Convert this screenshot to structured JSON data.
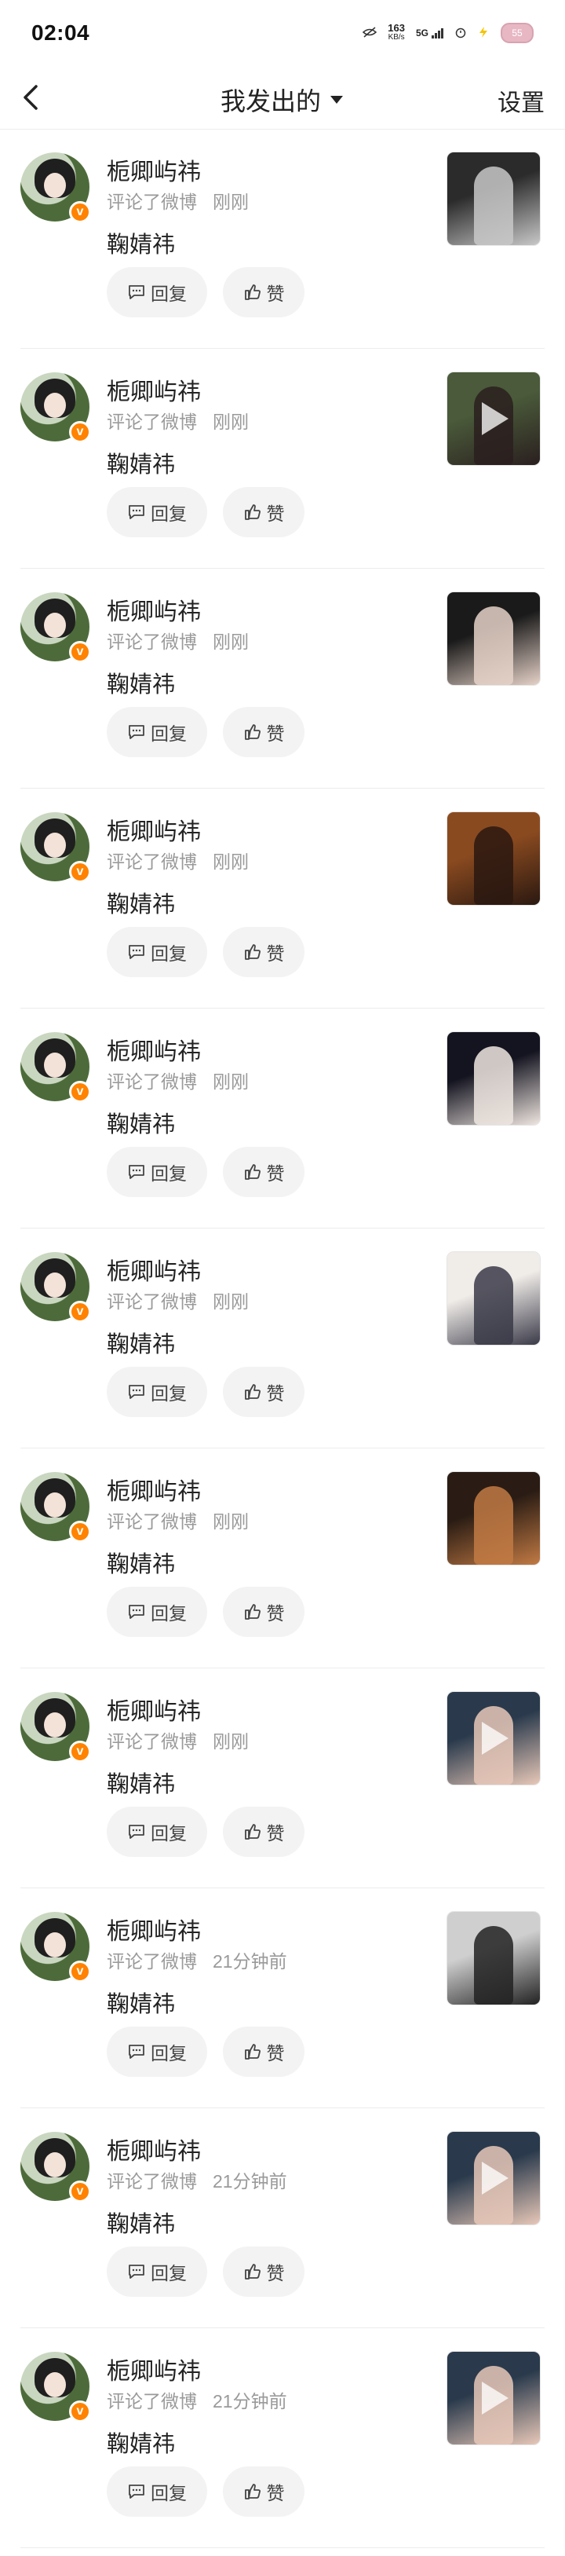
{
  "status_bar": {
    "time": "02:04",
    "net_speed_value": "163",
    "net_speed_unit": "KB/s",
    "network": "5G",
    "battery": "55"
  },
  "header": {
    "title": "我发出的",
    "settings": "设置"
  },
  "reply_label": "回复",
  "like_label": "赞",
  "items": [
    {
      "username": "栀卿屿祎",
      "action": "评论了微博",
      "time": "刚刚",
      "comment": "鞠婧祎",
      "thumb": {
        "has_play": false,
        "bg": "#2b2b2b",
        "accent": "#c8c8c8"
      }
    },
    {
      "username": "栀卿屿祎",
      "action": "评论了微博",
      "time": "刚刚",
      "comment": "鞠婧祎",
      "thumb": {
        "has_play": true,
        "bg": "#4a5a3a",
        "accent": "#2a1f1f"
      }
    },
    {
      "username": "栀卿屿祎",
      "action": "评论了微博",
      "time": "刚刚",
      "comment": "鞠婧祎",
      "thumb": {
        "has_play": false,
        "bg": "#1a1a1a",
        "accent": "#e6d2c8"
      }
    },
    {
      "username": "栀卿屿祎",
      "action": "评论了微博",
      "time": "刚刚",
      "comment": "鞠婧祎",
      "thumb": {
        "has_play": false,
        "bg": "#8a4a20",
        "accent": "#2a1810"
      }
    },
    {
      "username": "栀卿屿祎",
      "action": "评论了微博",
      "time": "刚刚",
      "comment": "鞠婧祎",
      "thumb": {
        "has_play": false,
        "bg": "#141420",
        "accent": "#efe6e0"
      }
    },
    {
      "username": "栀卿屿祎",
      "action": "评论了微博",
      "time": "刚刚",
      "comment": "鞠婧祎",
      "thumb": {
        "has_play": false,
        "bg": "#f0ece8",
        "accent": "#3a3a48"
      }
    },
    {
      "username": "栀卿屿祎",
      "action": "评论了微博",
      "time": "刚刚",
      "comment": "鞠婧祎",
      "thumb": {
        "has_play": false,
        "bg": "#2a1c14",
        "accent": "#c27a44"
      }
    },
    {
      "username": "栀卿屿祎",
      "action": "评论了微博",
      "time": "刚刚",
      "comment": "鞠婧祎",
      "thumb": {
        "has_play": true,
        "bg": "#2a3a4c",
        "accent": "#e8c8b8"
      }
    },
    {
      "username": "栀卿屿祎",
      "action": "评论了微博",
      "time": "21分钟前",
      "comment": "鞠婧祎",
      "thumb": {
        "has_play": false,
        "bg": "#cfcfcf",
        "accent": "#222222"
      }
    },
    {
      "username": "栀卿屿祎",
      "action": "评论了微博",
      "time": "21分钟前",
      "comment": "鞠婧祎",
      "thumb": {
        "has_play": true,
        "bg": "#2a3a4c",
        "accent": "#e8c8b8"
      }
    },
    {
      "username": "栀卿屿祎",
      "action": "评论了微博",
      "time": "21分钟前",
      "comment": "鞠婧祎",
      "thumb": {
        "has_play": true,
        "bg": "#2a3a4c",
        "accent": "#e8c8b8"
      }
    }
  ]
}
